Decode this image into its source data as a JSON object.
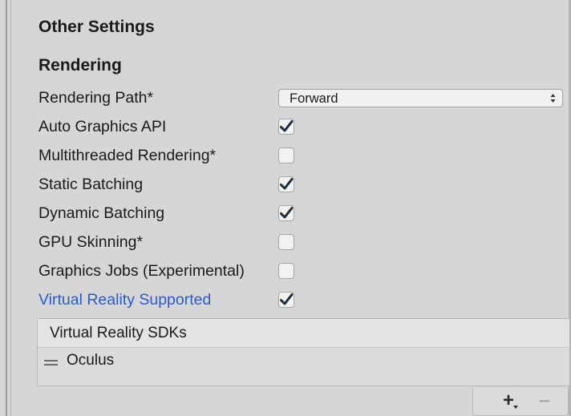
{
  "section": {
    "title": "Other Settings",
    "subtitle": "Rendering"
  },
  "rows": [
    {
      "label": "Rendering Path*",
      "type": "dropdown",
      "value": "Forward"
    },
    {
      "label": "Auto Graphics API",
      "type": "checkbox",
      "checked": true
    },
    {
      "label": "Multithreaded Rendering*",
      "type": "checkbox",
      "checked": false
    },
    {
      "label": "Static Batching",
      "type": "checkbox",
      "checked": true
    },
    {
      "label": "Dynamic Batching",
      "type": "checkbox",
      "checked": true
    },
    {
      "label": "GPU Skinning*",
      "type": "checkbox",
      "checked": false
    },
    {
      "label": "Graphics Jobs (Experimental)",
      "type": "checkbox",
      "checked": false
    },
    {
      "label": "Virtual Reality Supported",
      "type": "checkbox",
      "checked": true
    }
  ],
  "sdk_list": {
    "header": "Virtual Reality SDKs",
    "items": [
      "Oculus"
    ],
    "add_label": "+",
    "remove_label": "−"
  },
  "colors": {
    "link_blue": "#2a5ccf",
    "panel_bg": "#d6d6d6"
  }
}
